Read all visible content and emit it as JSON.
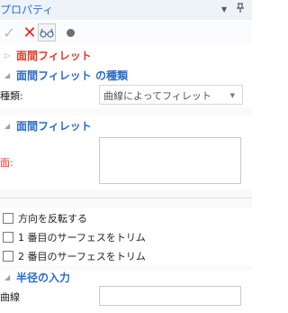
{
  "titlebar": {
    "title": "プロパティ",
    "dropdown_glyph": "▼",
    "pin_glyph": "ꟸ"
  },
  "toolbar": {
    "ok_glyph": "✓",
    "cancel_glyph": "✕",
    "preview_glyph": "",
    "dot_glyph": ""
  },
  "icons": {
    "ok": "check-icon",
    "cancel": "close-icon",
    "preview": "glasses-icon",
    "dot": "circle-icon"
  },
  "feature": {
    "title": "面間フィレット"
  },
  "section_type": {
    "title": "面間フィレット の種類",
    "type_label": "種類:",
    "type_value": "曲線によってフィレット"
  },
  "section_faces": {
    "title": "面間フィレット",
    "face_label": "面:"
  },
  "options": [
    {
      "label": "方向を反転する",
      "checked": false
    },
    {
      "label": "1 番目のサーフェスをトリム",
      "checked": false
    },
    {
      "label": "2 番目のサーフェスをトリム",
      "checked": false
    }
  ],
  "section_radius": {
    "title": "半径の入力",
    "curve_label": "曲線",
    "curve_value": ""
  },
  "colors": {
    "title_blue": "#2b70c9",
    "header_red": "#e23a2b",
    "header_blue": "#2b6cc4",
    "cancel_red": "#e52222"
  }
}
